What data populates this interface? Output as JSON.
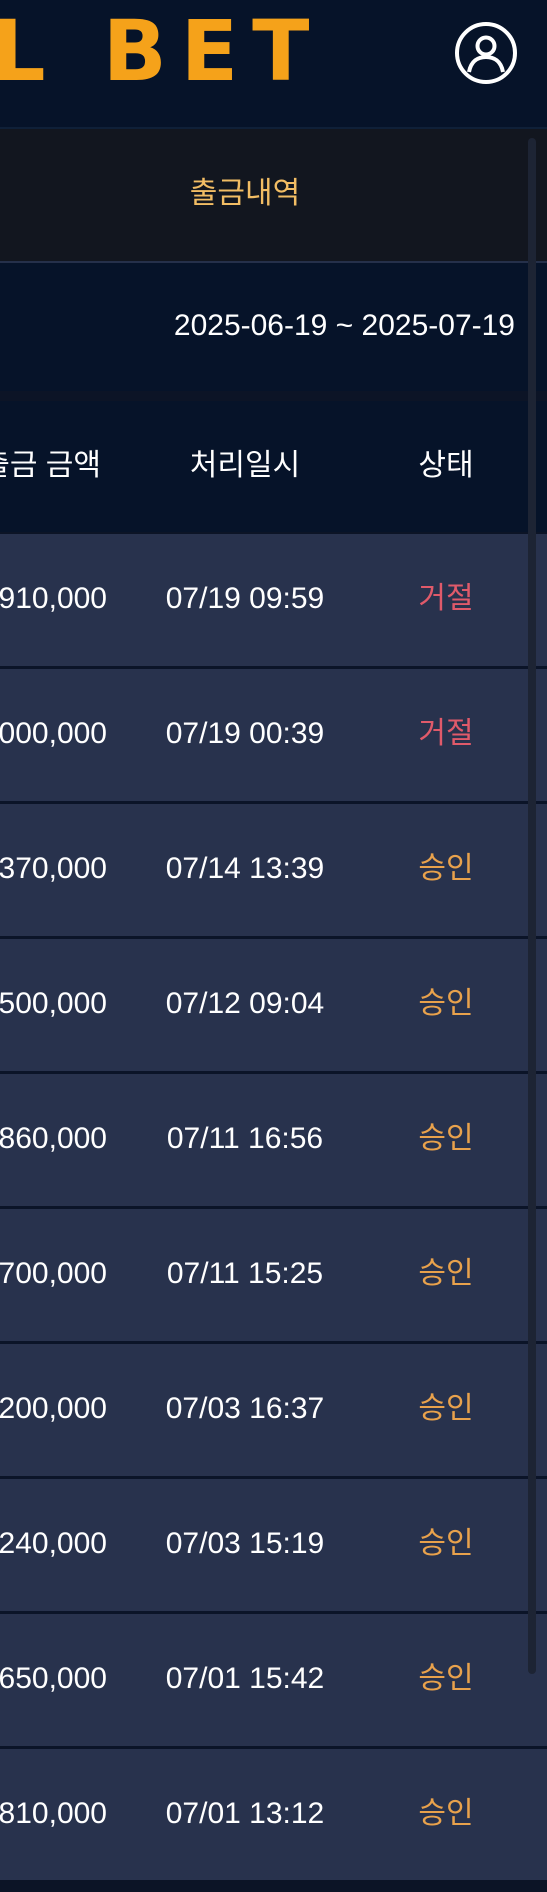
{
  "header": {
    "logo_text": "L BET",
    "user_icon": "user-circle-icon"
  },
  "tabs": {
    "active_label": "출금내역"
  },
  "filter": {
    "date_range": "2025-06-19 ~ 2025-07-19"
  },
  "table": {
    "headers": {
      "amount": "출금 금액",
      "processed_at": "처리일시",
      "status": "상태"
    },
    "rows": [
      {
        "amount": ",910,000",
        "processed_at": "07/19 09:59",
        "status": "거절",
        "status_kind": "reject"
      },
      {
        "amount": ",000,000",
        "processed_at": "07/19 00:39",
        "status": "거절",
        "status_kind": "reject"
      },
      {
        "amount": "370,000",
        "processed_at": "07/14 13:39",
        "status": "승인",
        "status_kind": "approve"
      },
      {
        "amount": "500,000",
        "processed_at": "07/12 09:04",
        "status": "승인",
        "status_kind": "approve"
      },
      {
        "amount": ",860,000",
        "processed_at": "07/11 16:56",
        "status": "승인",
        "status_kind": "approve"
      },
      {
        "amount": "700,000",
        "processed_at": "07/11 15:25",
        "status": "승인",
        "status_kind": "approve"
      },
      {
        "amount": "200,000",
        "processed_at": "07/03 16:37",
        "status": "승인",
        "status_kind": "approve"
      },
      {
        "amount": "240,000",
        "processed_at": "07/03 15:19",
        "status": "승인",
        "status_kind": "approve"
      },
      {
        "amount": "650,000",
        "processed_at": "07/01 15:42",
        "status": "승인",
        "status_kind": "approve"
      },
      {
        "amount": ",810,000",
        "processed_at": "07/01 13:12",
        "status": "승인",
        "status_kind": "approve"
      }
    ]
  },
  "colors": {
    "brand": "#f5a21a",
    "tab_active": "#f2bd64",
    "status_reject": "#e05a6a",
    "status_approve": "#e9a24c",
    "row_bg": "#28324d",
    "header_bg": "#061329"
  }
}
